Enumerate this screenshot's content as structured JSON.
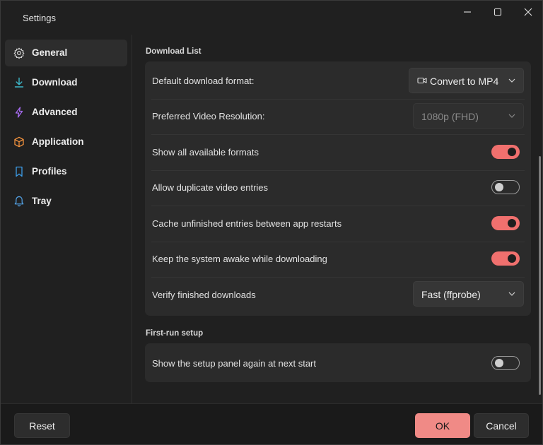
{
  "window": {
    "title": "Settings",
    "controls": {
      "minimize": "minimize-icon",
      "maximize": "maximize-icon",
      "close": "close-icon"
    }
  },
  "colors": {
    "accent": "#f0706e",
    "primary_button": "#f08a86",
    "background": "#202020",
    "card": "#2b2b2b"
  },
  "sidebar": {
    "items": [
      {
        "label": "General",
        "icon": "gear-icon",
        "active": true
      },
      {
        "label": "Download",
        "icon": "download-icon",
        "active": false
      },
      {
        "label": "Advanced",
        "icon": "lightning-icon",
        "active": false
      },
      {
        "label": "Application",
        "icon": "cube-icon",
        "active": false
      },
      {
        "label": "Profiles",
        "icon": "bookmark-icon",
        "active": false
      },
      {
        "label": "Tray",
        "icon": "bell-icon",
        "active": false
      }
    ]
  },
  "main": {
    "download_list": {
      "title": "Download List",
      "rows": [
        {
          "label": "Default download format:",
          "control": "dropdown",
          "value": "Convert to MP4",
          "icon": "video-camera-icon"
        },
        {
          "label": "Preferred Video Resolution:",
          "control": "dropdown",
          "value": "1080p (FHD)",
          "disabled": true
        },
        {
          "label": "Show all available formats",
          "control": "toggle",
          "on": true
        },
        {
          "label": "Allow duplicate video entries",
          "control": "toggle",
          "on": false
        },
        {
          "label": "Cache unfinished entries between app restarts",
          "control": "toggle",
          "on": true
        },
        {
          "label": "Keep the system awake while downloading",
          "control": "toggle",
          "on": true
        },
        {
          "label": "Verify finished downloads",
          "control": "dropdown",
          "value": "Fast (ffprobe)"
        }
      ]
    },
    "first_run": {
      "title": "First-run setup",
      "rows": [
        {
          "label": "Show the setup panel again at next start",
          "control": "toggle",
          "on": false
        }
      ]
    }
  },
  "footer": {
    "reset_label": "Reset",
    "ok_label": "OK",
    "cancel_label": "Cancel"
  }
}
